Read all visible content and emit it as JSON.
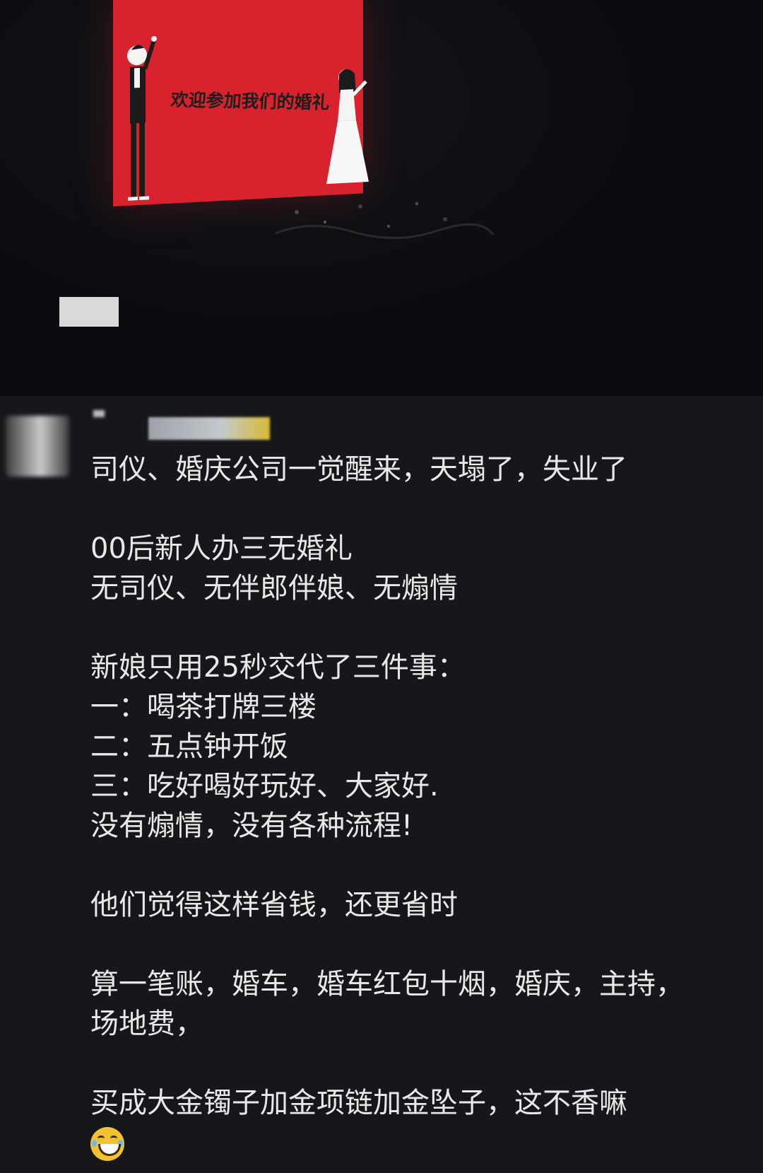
{
  "photo": {
    "screen_text": "欢迎参加我们的婚礼",
    "screen_color": "#d8232e",
    "groom_icon": "groom-figure-icon",
    "bride_icon": "bride-figure-icon"
  },
  "author": {
    "avatar": "blurred-avatar",
    "name_redacted": true
  },
  "post": {
    "lines": [
      "司仪、婚庆公司一觉醒来，天塌了，失业了",
      "",
      "00后新人办三无婚礼",
      "无司仪、无伴郎伴娘、无煽情",
      "",
      "新娘只用25秒交代了三件事：",
      "一：喝茶打牌三楼",
      "二：五点钟开饭",
      "三：吃好喝好玩好、大家好.",
      "没有煽情，没有各种流程!",
      "",
      "他们觉得这样省钱，还更省时",
      "",
      "算一笔账，婚车，婚车红包十烟，婚庆，主持，",
      "场地费，",
      "",
      "买成大金镯子加金项链加金坠子，这不香嘛"
    ],
    "emoji": "laughing-with-tears-emoji"
  }
}
